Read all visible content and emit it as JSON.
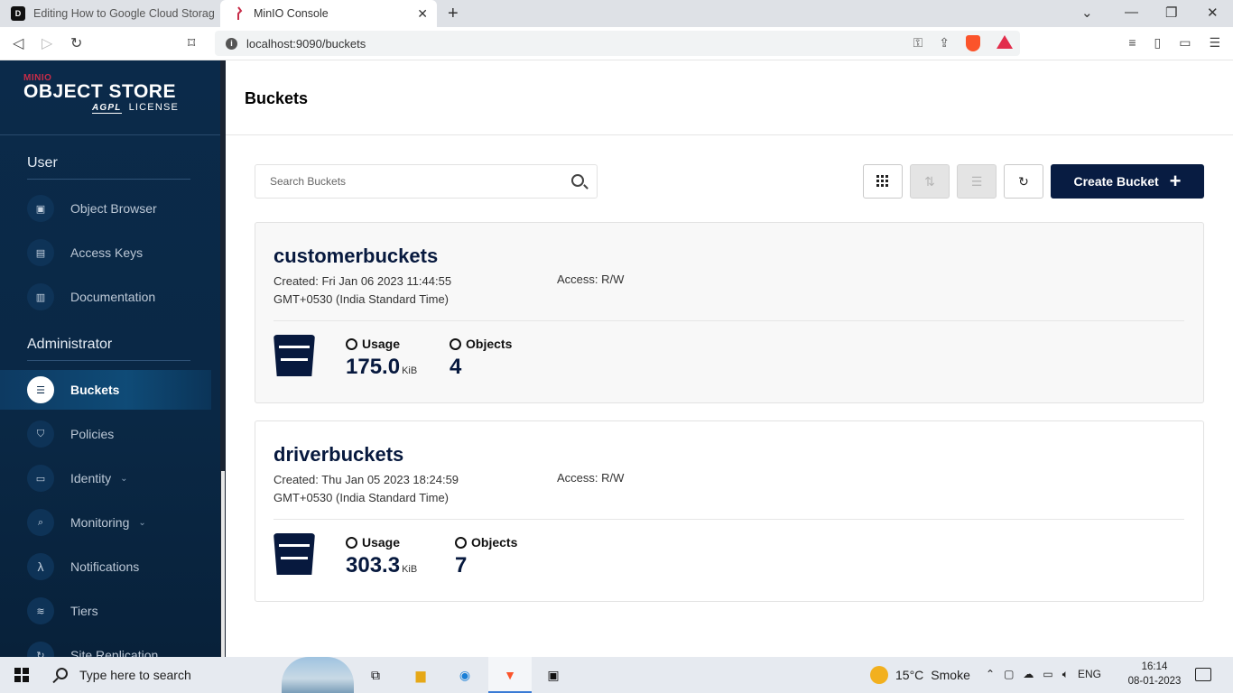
{
  "browser": {
    "tabs": [
      {
        "title": "Editing How to Google Cloud Storage",
        "active": false
      },
      {
        "title": "MinIO Console",
        "active": true
      }
    ],
    "url": "localhost:9090/buckets"
  },
  "sidebar": {
    "logo": {
      "brand": "MINIO",
      "product": "OBJECT STORE",
      "license_badge": "AGPL",
      "license": "LICENSE"
    },
    "sections": [
      {
        "title": "User",
        "items": [
          {
            "label": "Object Browser",
            "icon": "object-browser-icon"
          },
          {
            "label": "Access Keys",
            "icon": "access-keys-icon"
          },
          {
            "label": "Documentation",
            "icon": "documentation-icon"
          }
        ]
      },
      {
        "title": "Administrator",
        "items": [
          {
            "label": "Buckets",
            "icon": "bucket-icon",
            "active": true
          },
          {
            "label": "Policies",
            "icon": "policies-icon"
          },
          {
            "label": "Identity",
            "icon": "identity-icon",
            "expandable": true
          },
          {
            "label": "Monitoring",
            "icon": "monitoring-icon",
            "expandable": true
          },
          {
            "label": "Notifications",
            "icon": "lambda-icon"
          },
          {
            "label": "Tiers",
            "icon": "tiers-icon"
          },
          {
            "label": "Site Replication",
            "icon": "replication-icon"
          }
        ]
      }
    ]
  },
  "main": {
    "title": "Buckets",
    "search": {
      "placeholder": "Search Buckets",
      "value": ""
    },
    "toolbar": {
      "create_label": "Create Bucket"
    },
    "buckets": [
      {
        "name": "customerbuckets",
        "created_line1": "Created: Fri Jan 06 2023 11:44:55",
        "created_line2": "GMT+0530 (India Standard Time)",
        "access": "Access: R/W",
        "usage_label": "Usage",
        "usage_value": "175.0",
        "usage_unit": "KiB",
        "objects_label": "Objects",
        "objects_value": "4"
      },
      {
        "name": "driverbuckets",
        "created_line1": "Created: Thu Jan 05 2023 18:24:59",
        "created_line2": "GMT+0530 (India Standard Time)",
        "access": "Access: R/W",
        "usage_label": "Usage",
        "usage_value": "303.3",
        "usage_unit": "KiB",
        "objects_label": "Objects",
        "objects_value": "7"
      }
    ]
  },
  "taskbar": {
    "search_placeholder": "Type here to search",
    "weather_temp": "15°C",
    "weather_text": "Smoke",
    "language": "ENG",
    "time": "16:14",
    "date": "08-01-2023"
  },
  "colors": {
    "sidebar_bg": "#0b2a4a",
    "primary_button": "#081c42",
    "bucket_name": "#07193e"
  }
}
